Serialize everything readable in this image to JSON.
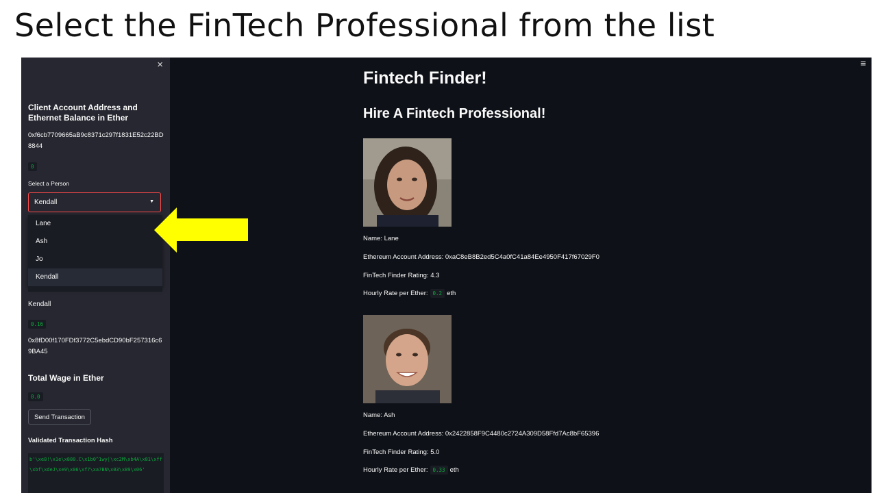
{
  "slide_title": "Select the FinTech Professional from the list",
  "sidebar": {
    "close_icon": "×",
    "account_heading": "Client Account Address and Ethernet Balance in Ether",
    "account_address": "0xf6cb7709665aB9c8371c297f1831E52c22BD8844",
    "balance": "0",
    "select_label": "Select a Person",
    "selected": "Kendall",
    "options": [
      "Lane",
      "Ash",
      "Jo",
      "Kendall"
    ],
    "person_name": "Kendall",
    "person_rate": "0.16",
    "person_address": "0x8fD00f170FDf3772C5ebdCD90bF257316c69BA45",
    "total_wage_heading": "Total Wage in Ether",
    "total_wage": "0.0",
    "send_button": "Send Transaction",
    "hash_heading": "Validated Transaction Hash",
    "hash_value": "b'\\xe8!\\x1e\\x880.C\\x1b0^1wy|\\xc2M\\xb4A\\x81\\xff\\xbf\\xdeJ\\xe9\\x06\\xf7\\xa7BN\\x03\\x89\\x06'"
  },
  "main": {
    "hamburger_icon": "≡",
    "title": "Fintech Finder!",
    "subtitle": "Hire A Fintech Professional!",
    "rate_label": "Hourly Rate per Ether:",
    "rate_unit": "eth",
    "profiles": [
      {
        "name": "Name: Lane",
        "address": "Ethereum Account Address: 0xaC8eB8B2ed5C4a0fC41a84Ee4950F417f67029F0",
        "rating": "FinTech Finder Rating: 4.3",
        "rate": "0.2"
      },
      {
        "name": "Name: Ash",
        "address": "Ethereum Account Address: 0x2422858F9C4480c2724A309D58Ffd7Ac8bF65396",
        "rating": "FinTech Finder Rating: 5.0",
        "rate": "0.33"
      }
    ]
  },
  "colors": {
    "app_bg": "#0e1117",
    "sidebar_bg": "#262730",
    "accent_red": "#ff4b4b",
    "code_green": "#09ab3b",
    "arrow_yellow": "#ffff00"
  }
}
